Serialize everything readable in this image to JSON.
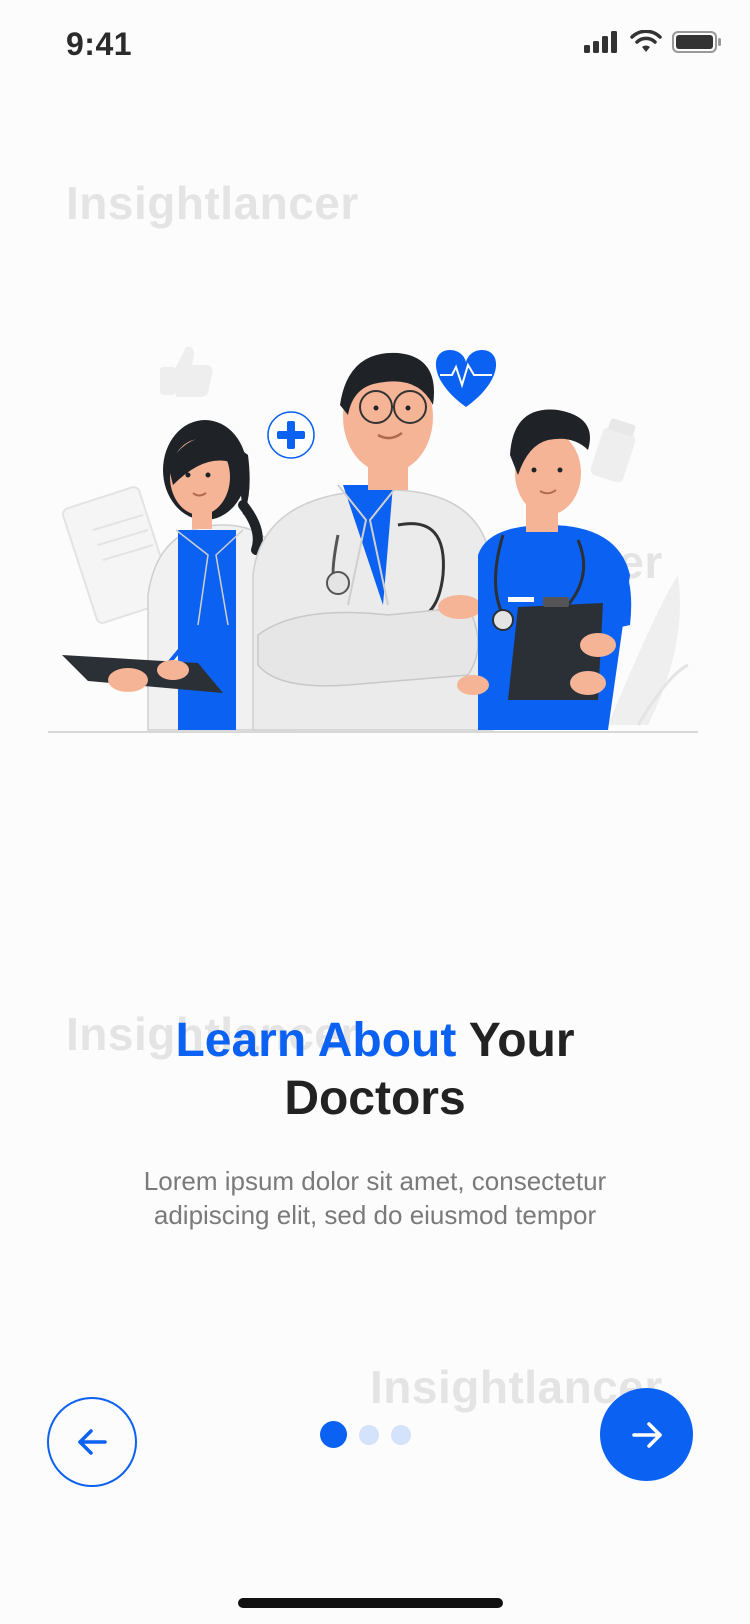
{
  "status_bar": {
    "time": "9:41"
  },
  "watermarks": [
    "Insightlancer",
    "Insightlancer",
    "Insightlancer",
    "Insightlancer"
  ],
  "onboarding": {
    "title_accent": "Learn About",
    "title_rest": "Your",
    "title_line2": "Doctors",
    "subtitle_line1": "Lorem ipsum dolor sit amet, consectetur",
    "subtitle_line2": "adipiscing elit, sed do eiusmod tempor"
  },
  "pagination": {
    "total": 3,
    "current": 1
  },
  "icons": {
    "back": "arrow-left-icon",
    "next": "arrow-right-icon",
    "signal": "cellular-signal-icon",
    "wifi": "wifi-icon",
    "battery": "battery-icon"
  },
  "colors": {
    "accent": "#0B61F1",
    "dot_inactive": "#D5E2FB",
    "text_dark": "#222222",
    "text_muted": "#7A7A7A"
  }
}
